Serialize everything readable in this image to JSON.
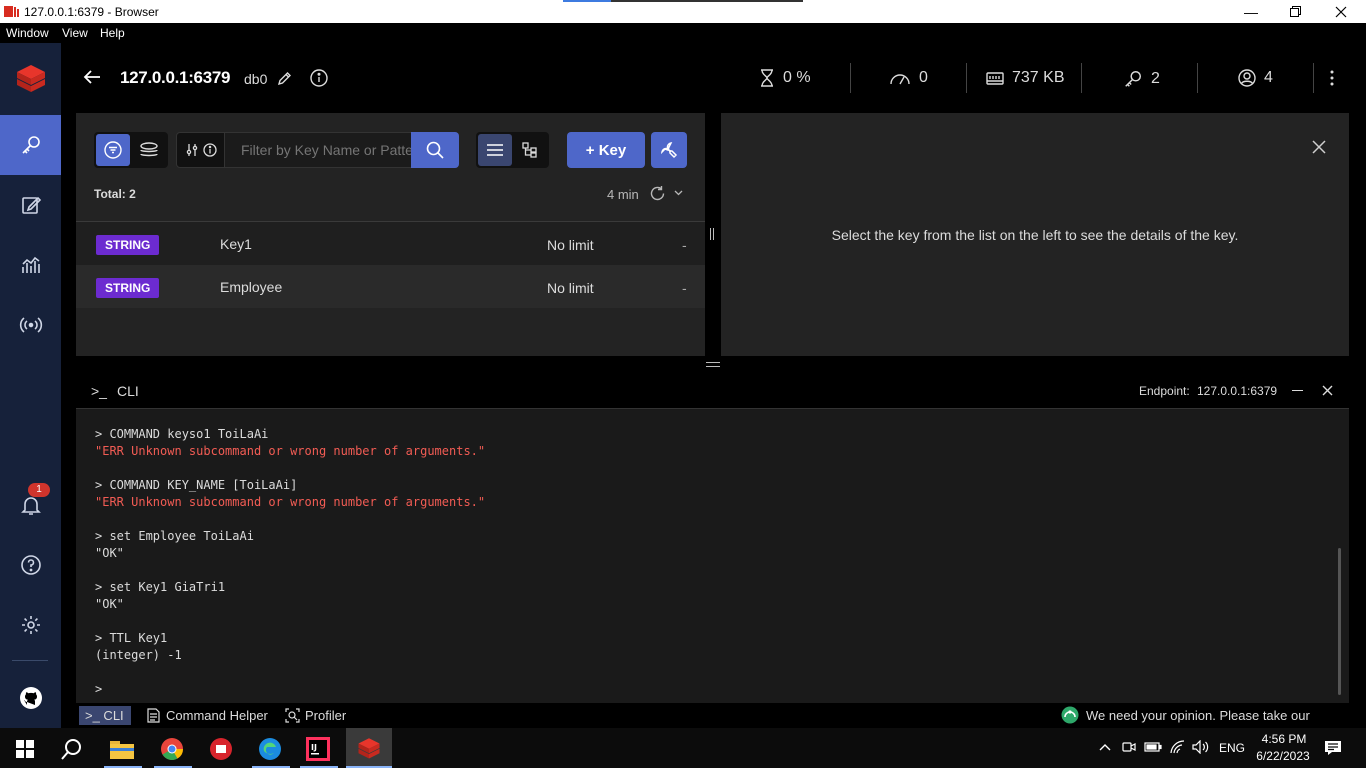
{
  "window": {
    "title": "127.0.0.1:6379 - Browser",
    "menu": [
      "Window",
      "View",
      "Help"
    ]
  },
  "header": {
    "host": "127.0.0.1:6379",
    "db": "db0",
    "cpu": "0 %",
    "ops": "0",
    "memory": "737 KB",
    "keys": "2",
    "clients": "4"
  },
  "toolbar": {
    "search_placeholder": "Filter by Key Name or Pattern",
    "add_key_label": "+ Key"
  },
  "list": {
    "total": "Total: 2",
    "refresh_label": "4 min",
    "rows": [
      {
        "type": "STRING",
        "name": "Key1",
        "ttl": "No limit",
        "size": "-"
      },
      {
        "type": "STRING",
        "name": "Employee",
        "ttl": "No limit",
        "size": "-"
      }
    ]
  },
  "details": {
    "empty_message": "Select the key from the list on the left to see the details of the key."
  },
  "cli": {
    "title": "CLI",
    "prompt_icon": ">_",
    "endpoint_label": "Endpoint:",
    "endpoint_value": "127.0.0.1:6379",
    "lines": [
      {
        "kind": "cmd",
        "text": "> COMMAND keyso1 ToiLaAi"
      },
      {
        "kind": "err",
        "text": "\"ERR Unknown subcommand or wrong number of arguments.\""
      },
      {
        "kind": "cmd",
        "text": "> COMMAND KEY_NAME [ToiLaAi]"
      },
      {
        "kind": "err",
        "text": "\"ERR Unknown subcommand or wrong number of arguments.\""
      },
      {
        "kind": "cmd",
        "text": "> set Employee ToiLaAi"
      },
      {
        "kind": "ok",
        "text": "\"OK\""
      },
      {
        "kind": "cmd",
        "text": "> set Key1 GiaTri1"
      },
      {
        "kind": "ok",
        "text": "\"OK\""
      },
      {
        "kind": "cmd",
        "text": "> TTL Key1"
      },
      {
        "kind": "ok",
        "text": "(integer) -1"
      },
      {
        "kind": "cmd",
        "text": ">"
      }
    ]
  },
  "bottombar": {
    "cli_tab": ">_ CLI",
    "helper_tab": "Command Helper",
    "profiler_tab": "Profiler",
    "survey": "We need your opinion. Please take our survey."
  },
  "nav": {
    "notification_count": "1"
  },
  "taskbar": {
    "time": "4:56 PM",
    "date": "6/22/2023",
    "language": "ENG"
  },
  "colors": {
    "accent": "#4e67c9",
    "string_badge": "#6c2bd0",
    "error_text": "#f25c54",
    "notification": "#d0342c"
  }
}
